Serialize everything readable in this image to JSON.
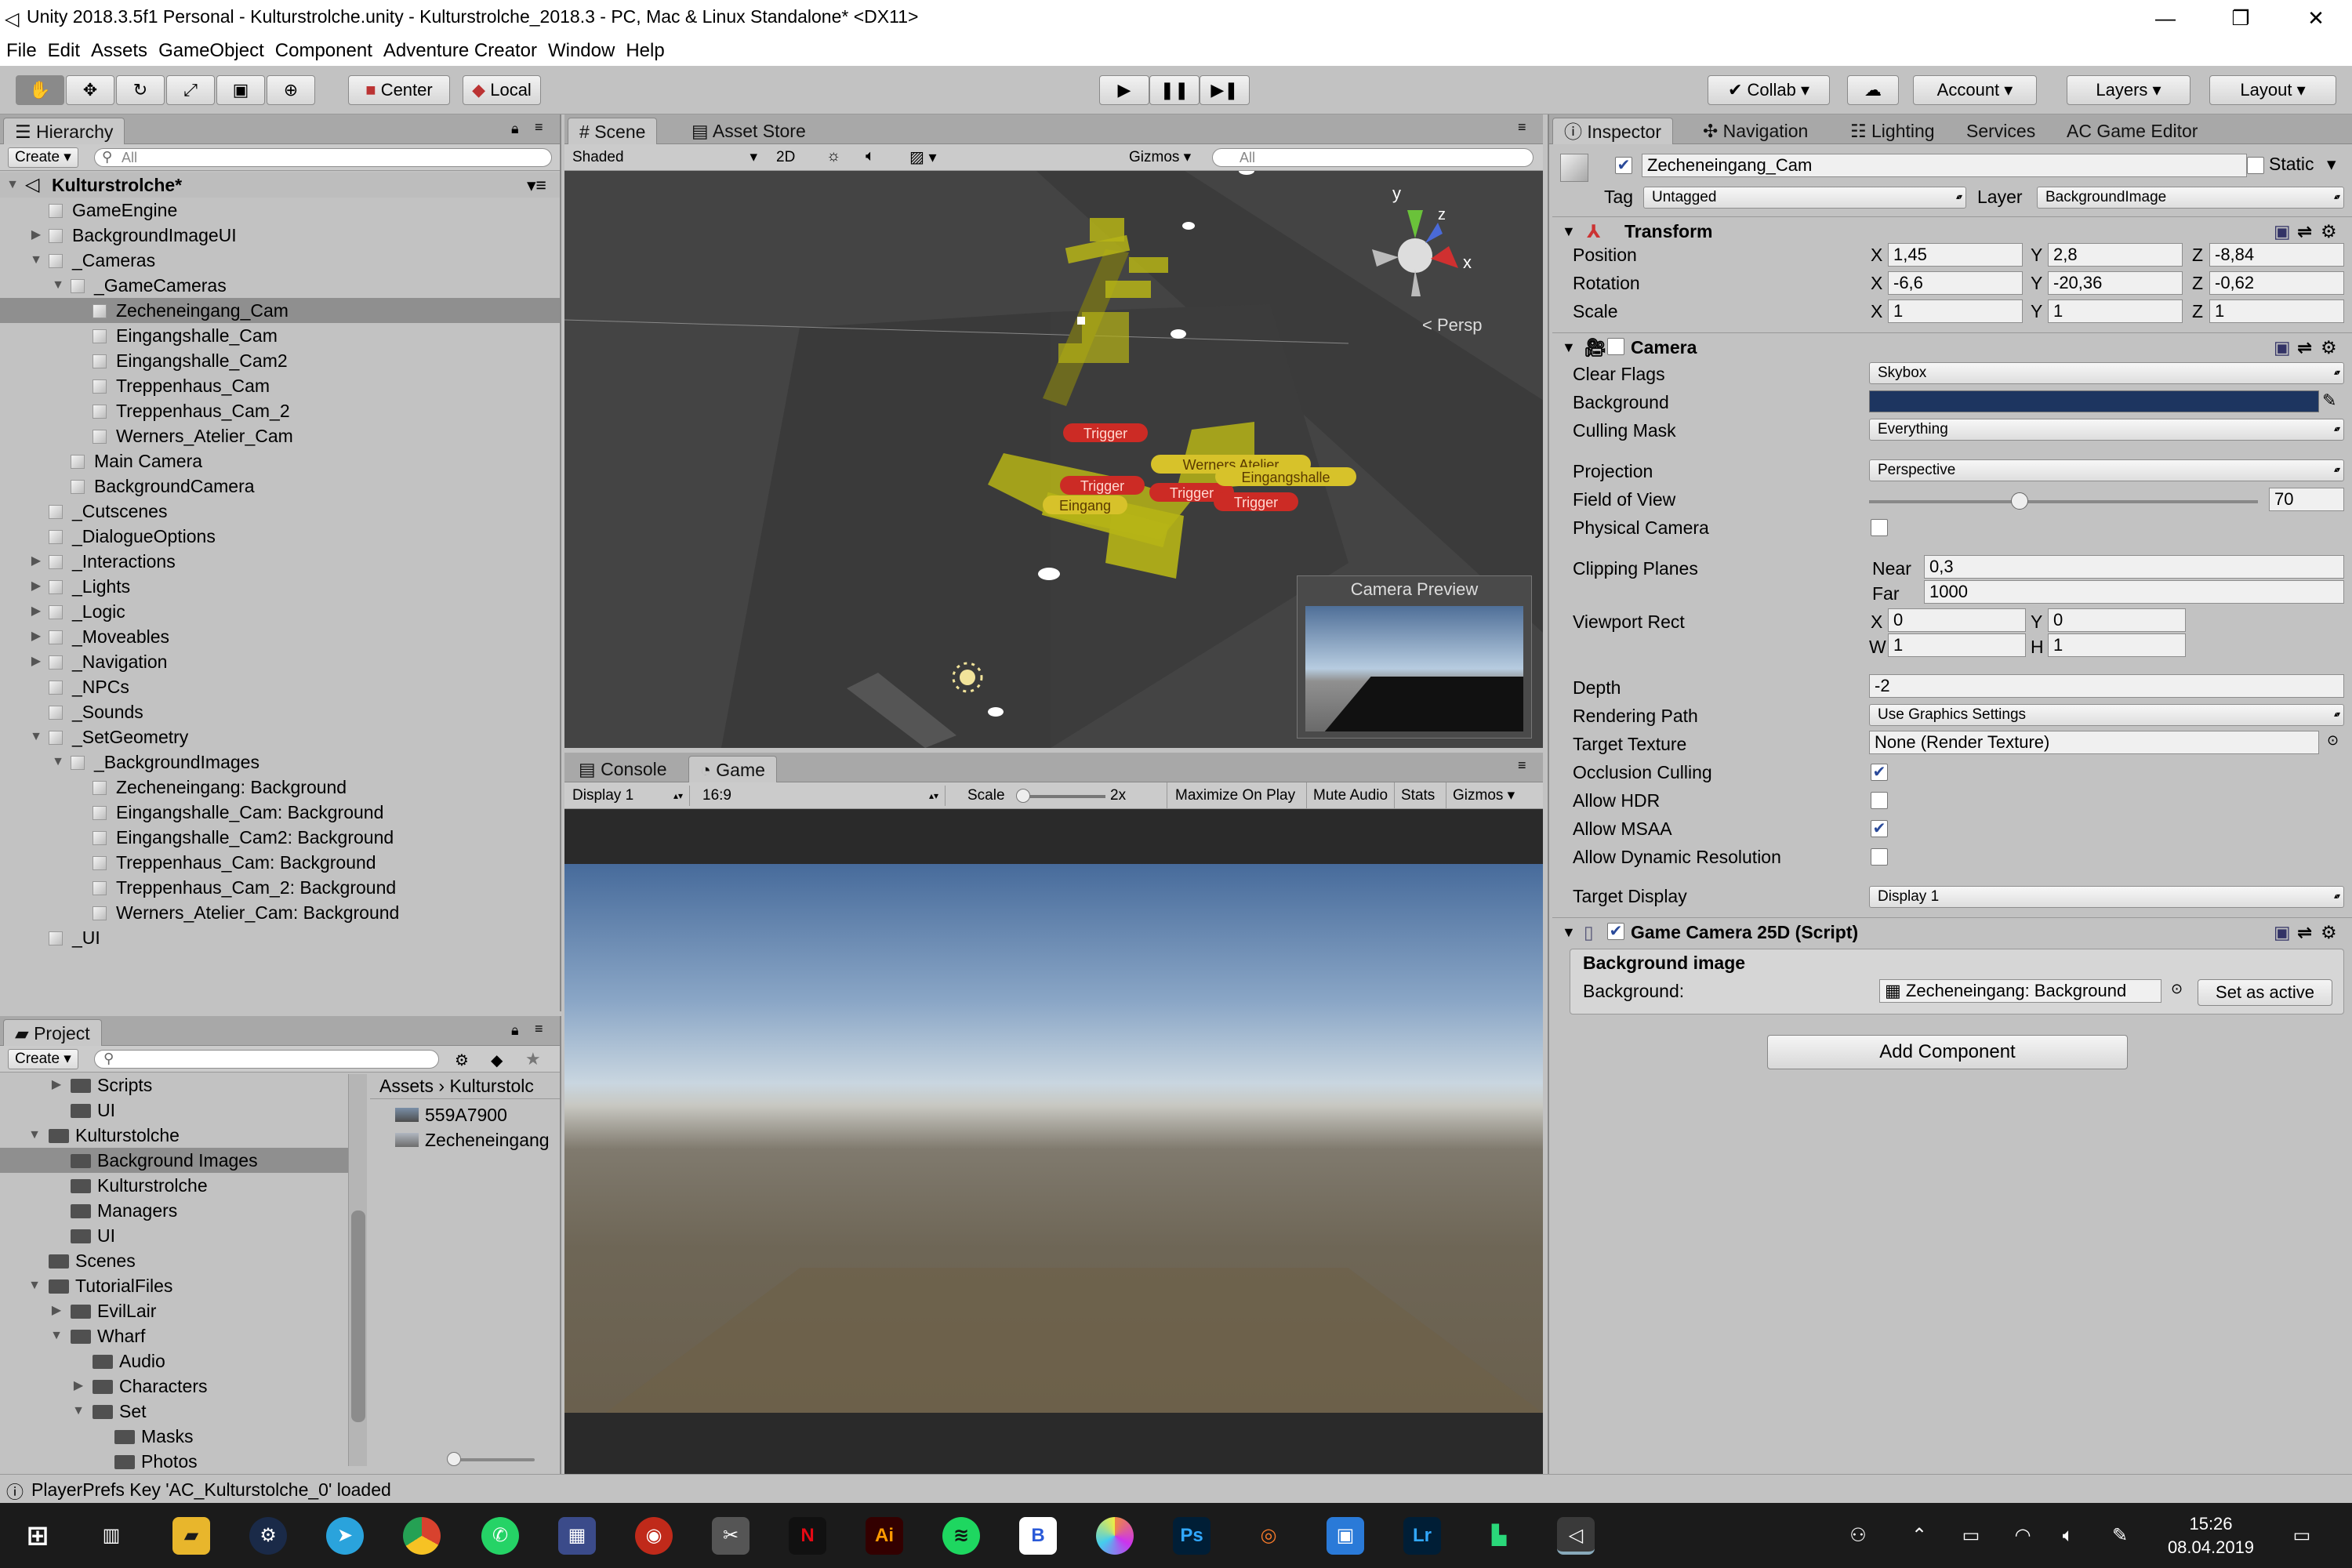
{
  "window": {
    "title": "Unity 2018.3.5f1 Personal - Kulturstrolche.unity - Kulturstrolche_2018.3 - PC, Mac & Linux Standalone* <DX11>",
    "minimize": "—",
    "maximize": "❐",
    "close": "✕"
  },
  "menu": [
    "File",
    "Edit",
    "Assets",
    "GameObject",
    "Component",
    "Adventure Creator",
    "Window",
    "Help"
  ],
  "toolbar": {
    "center": "Center",
    "local": "Local",
    "collab": "Collab",
    "account": "Account",
    "layers": "Layers",
    "layout": "Layout",
    "play": "▶",
    "pause": "❚❚",
    "step": "▶❚"
  },
  "hierarchy": {
    "tab": "Hierarchy",
    "create": "Create",
    "search_placeholder": "All",
    "scene": "Kulturstrolche*",
    "items": [
      {
        "label": "GameEngine",
        "depth": 1,
        "arrow": ""
      },
      {
        "label": "BackgroundImageUI",
        "depth": 1,
        "arrow": "▶"
      },
      {
        "label": "_Cameras",
        "depth": 1,
        "arrow": "▼"
      },
      {
        "label": "_GameCameras",
        "depth": 2,
        "arrow": "▼"
      },
      {
        "label": "Zecheneingang_Cam",
        "depth": 3,
        "arrow": "",
        "selected": true
      },
      {
        "label": "Eingangshalle_Cam",
        "depth": 3,
        "arrow": ""
      },
      {
        "label": "Eingangshalle_Cam2",
        "depth": 3,
        "arrow": ""
      },
      {
        "label": "Treppenhaus_Cam",
        "depth": 3,
        "arrow": ""
      },
      {
        "label": "Treppenhaus_Cam_2",
        "depth": 3,
        "arrow": ""
      },
      {
        "label": "Werners_Atelier_Cam",
        "depth": 3,
        "arrow": ""
      },
      {
        "label": "Main Camera",
        "depth": 2,
        "arrow": ""
      },
      {
        "label": "BackgroundCamera",
        "depth": 2,
        "arrow": ""
      },
      {
        "label": "_Cutscenes",
        "depth": 1,
        "arrow": ""
      },
      {
        "label": "_DialogueOptions",
        "depth": 1,
        "arrow": ""
      },
      {
        "label": "_Interactions",
        "depth": 1,
        "arrow": "▶"
      },
      {
        "label": "_Lights",
        "depth": 1,
        "arrow": "▶"
      },
      {
        "label": "_Logic",
        "depth": 1,
        "arrow": "▶"
      },
      {
        "label": "_Moveables",
        "depth": 1,
        "arrow": "▶"
      },
      {
        "label": "_Navigation",
        "depth": 1,
        "arrow": "▶"
      },
      {
        "label": "_NPCs",
        "depth": 1,
        "arrow": ""
      },
      {
        "label": "_Sounds",
        "depth": 1,
        "arrow": ""
      },
      {
        "label": "_SetGeometry",
        "depth": 1,
        "arrow": "▼"
      },
      {
        "label": "_BackgroundImages",
        "depth": 2,
        "arrow": "▼"
      },
      {
        "label": "Zecheneingang: Background",
        "depth": 3,
        "arrow": ""
      },
      {
        "label": "Eingangshalle_Cam: Background",
        "depth": 3,
        "arrow": ""
      },
      {
        "label": "Eingangshalle_Cam2: Background",
        "depth": 3,
        "arrow": ""
      },
      {
        "label": "Treppenhaus_Cam: Background",
        "depth": 3,
        "arrow": ""
      },
      {
        "label": "Treppenhaus_Cam_2: Background",
        "depth": 3,
        "arrow": ""
      },
      {
        "label": "Werners_Atelier_Cam: Background",
        "depth": 3,
        "arrow": ""
      },
      {
        "label": "_UI",
        "depth": 1,
        "arrow": ""
      }
    ]
  },
  "project": {
    "tab": "Project",
    "create": "Create",
    "tree": [
      {
        "label": "Scripts",
        "depth": 2,
        "arrow": "▶"
      },
      {
        "label": "UI",
        "depth": 2,
        "arrow": ""
      },
      {
        "label": "Kulturstolche",
        "depth": 1,
        "arrow": "▼"
      },
      {
        "label": "Background Images",
        "depth": 2,
        "arrow": "",
        "selected": true
      },
      {
        "label": "Kulturstrolche",
        "depth": 2,
        "arrow": ""
      },
      {
        "label": "Managers",
        "depth": 2,
        "arrow": ""
      },
      {
        "label": "UI",
        "depth": 2,
        "arrow": ""
      },
      {
        "label": "Scenes",
        "depth": 1,
        "arrow": ""
      },
      {
        "label": "TutorialFiles",
        "depth": 1,
        "arrow": "▼"
      },
      {
        "label": "EvilLair",
        "depth": 2,
        "arrow": "▶"
      },
      {
        "label": "Wharf",
        "depth": 2,
        "arrow": "▼"
      },
      {
        "label": "Audio",
        "depth": 3,
        "arrow": ""
      },
      {
        "label": "Characters",
        "depth": 3,
        "arrow": "▶"
      },
      {
        "label": "Set",
        "depth": 3,
        "arrow": "▼"
      },
      {
        "label": "Masks",
        "depth": 4,
        "arrow": ""
      },
      {
        "label": "Photos",
        "depth": 4,
        "arrow": ""
      }
    ],
    "breadcrumb": [
      "Assets",
      "Kulturstolc"
    ],
    "assets": [
      "559A7900",
      "Zecheneingang"
    ]
  },
  "scene": {
    "tabs": [
      "Scene",
      "Asset Store"
    ],
    "shading": "Shaded",
    "mode2d": "2D",
    "gizmos": "Gizmos",
    "search_placeholder": "All",
    "persp": "< Persp",
    "axis_y": "y",
    "axis_x": "x",
    "axis_z": "z",
    "labels": [
      {
        "text": "Werners Atelier",
        "kind": "yellow"
      },
      {
        "text": "Trigger",
        "kind": "red"
      },
      {
        "text": "Trigger",
        "kind": "red"
      },
      {
        "text": "Eingangshalle",
        "kind": "yellow"
      },
      {
        "text": "Trigger",
        "kind": "red"
      },
      {
        "text": "Trigger",
        "kind": "red"
      },
      {
        "text": "Eingang",
        "kind": "yellow"
      }
    ],
    "preview_title": "Camera Preview"
  },
  "game": {
    "tabs": [
      "Console",
      "Game"
    ],
    "display": "Display 1",
    "aspect": "16:9",
    "scale_label": "Scale",
    "scale_value": "2x",
    "maximize": "Maximize On Play",
    "mute": "Mute Audio",
    "stats": "Stats",
    "gizmos": "Gizmos"
  },
  "inspector": {
    "tabs": [
      "Inspector",
      "Navigation",
      "Lighting",
      "Services",
      "AC Game Editor"
    ],
    "object_name": "Zecheneingang_Cam",
    "static_label": "Static",
    "tag_label": "Tag",
    "tag": "Untagged",
    "layer_label": "Layer",
    "layer": "BackgroundImage",
    "transform": {
      "title": "Transform",
      "rows": [
        {
          "label": "Position",
          "x": "1,45",
          "y": "2,8",
          "z": "-8,84"
        },
        {
          "label": "Rotation",
          "x": "-6,6",
          "y": "-20,36",
          "z": "-0,62"
        },
        {
          "label": "Scale",
          "x": "1",
          "y": "1",
          "z": "1"
        }
      ]
    },
    "camera": {
      "title": "Camera",
      "clear_flags_label": "Clear Flags",
      "clear_flags": "Skybox",
      "background_label": "Background",
      "background_color": "#1d3560",
      "culling_label": "Culling Mask",
      "culling": "Everything",
      "projection_label": "Projection",
      "projection": "Perspective",
      "fov_label": "Field of View",
      "fov": "70",
      "physical_label": "Physical Camera",
      "clipping_label": "Clipping Planes",
      "near_label": "Near",
      "near": "0,3",
      "far_label": "Far",
      "far": "1000",
      "viewport_label": "Viewport Rect",
      "vx": "0",
      "vy": "0",
      "vw": "1",
      "vh": "1",
      "depth_label": "Depth",
      "depth": "-2",
      "render_path_label": "Rendering Path",
      "render_path": "Use Graphics Settings",
      "target_tex_label": "Target Texture",
      "target_tex": "None (Render Texture)",
      "occlusion_label": "Occlusion Culling",
      "hdr_label": "Allow HDR",
      "msaa_label": "Allow MSAA",
      "dynres_label": "Allow Dynamic Resolution",
      "target_display_label": "Target Display",
      "target_display": "Display 1"
    },
    "script": {
      "title": "Game Camera 25D (Script)",
      "bg_header": "Background image",
      "bg_label": "Background:",
      "bg_value": "Zecheneingang: Background",
      "set_active": "Set as active"
    },
    "add_component": "Add Component"
  },
  "status": "PlayerPrefs Key 'AC_Kulturstolche_0' loaded",
  "clock": {
    "time": "15:26",
    "date": "08.04.2019"
  }
}
